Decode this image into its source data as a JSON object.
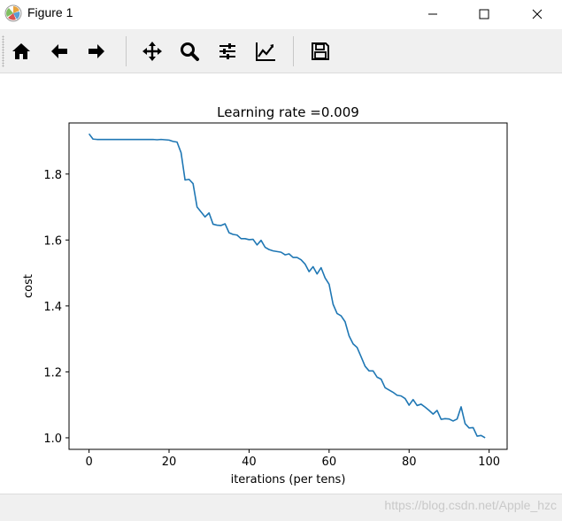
{
  "window": {
    "title": "Figure 1"
  },
  "toolbar": {
    "buttons": [
      {
        "name": "home",
        "icon": "home-icon"
      },
      {
        "name": "back",
        "icon": "arrow-left-icon"
      },
      {
        "name": "forward",
        "icon": "arrow-right-icon"
      },
      {
        "name": "pan",
        "icon": "move-icon"
      },
      {
        "name": "zoom",
        "icon": "magnifier-icon"
      },
      {
        "name": "subplots",
        "icon": "sliders-icon"
      },
      {
        "name": "edit-axes",
        "icon": "line-chart-icon"
      },
      {
        "name": "save",
        "icon": "floppy-disk-icon"
      }
    ]
  },
  "statusbar": {
    "watermark": "https://blog.csdn.net/Apple_hzc"
  },
  "colors": {
    "line": "#1f77b4",
    "toolbar_bg": "#f0f0f0"
  },
  "chart_data": {
    "type": "line",
    "title": "Learning rate =0.009",
    "xlabel": "iterations (per tens)",
    "ylabel": "cost",
    "xlim": [
      -5,
      104.5
    ],
    "ylim": [
      0.965,
      1.955
    ],
    "xticks": [
      0,
      20,
      40,
      60,
      80,
      100
    ],
    "xtick_labels": [
      "0",
      "20",
      "40",
      "60",
      "80",
      "100"
    ],
    "yticks": [
      1.0,
      1.2,
      1.4,
      1.6,
      1.8
    ],
    "ytick_labels": [
      "1.0",
      "1.2",
      "1.4",
      "1.6",
      "1.8"
    ],
    "grid": false,
    "series": [
      {
        "x": [
          0,
          1,
          2,
          3,
          4,
          5,
          6,
          7,
          8,
          9,
          10,
          11,
          12,
          13,
          14,
          15,
          16,
          17,
          18,
          19,
          20,
          21,
          22,
          23,
          24,
          25,
          26,
          27,
          28,
          29,
          30,
          31,
          32,
          33,
          34,
          35,
          36,
          37,
          38,
          39,
          40,
          41,
          42,
          43,
          44,
          45,
          46,
          47,
          48,
          49,
          50,
          51,
          52,
          53,
          54,
          55,
          56,
          57,
          58,
          59,
          60,
          61,
          62,
          63,
          64,
          65,
          66,
          67,
          68,
          69,
          70,
          71,
          72,
          73,
          74,
          75,
          76,
          77,
          78,
          79,
          80,
          81,
          82,
          83,
          84,
          85,
          86,
          87,
          88,
          89,
          90,
          91,
          92,
          93,
          94,
          95,
          96,
          97,
          98,
          99
        ],
        "values": [
          1.922,
          1.906,
          1.905,
          1.905,
          1.905,
          1.905,
          1.905,
          1.905,
          1.905,
          1.905,
          1.905,
          1.905,
          1.905,
          1.905,
          1.905,
          1.905,
          1.905,
          1.904,
          1.905,
          1.904,
          1.903,
          1.899,
          1.897,
          1.865,
          1.782,
          1.784,
          1.771,
          1.7,
          1.685,
          1.67,
          1.682,
          1.648,
          1.645,
          1.644,
          1.649,
          1.622,
          1.617,
          1.615,
          1.604,
          1.604,
          1.601,
          1.602,
          1.585,
          1.599,
          1.578,
          1.571,
          1.567,
          1.565,
          1.563,
          1.555,
          1.558,
          1.547,
          1.547,
          1.54,
          1.527,
          1.504,
          1.519,
          1.497,
          1.516,
          1.485,
          1.466,
          1.405,
          1.377,
          1.37,
          1.352,
          1.309,
          1.285,
          1.274,
          1.246,
          1.217,
          1.203,
          1.203,
          1.184,
          1.178,
          1.152,
          1.145,
          1.138,
          1.129,
          1.127,
          1.119,
          1.099,
          1.116,
          1.098,
          1.102,
          1.093,
          1.083,
          1.072,
          1.083,
          1.056,
          1.058,
          1.057,
          1.051,
          1.057,
          1.094,
          1.043,
          1.03,
          1.031,
          1.005,
          1.007,
          1.0
        ]
      }
    ]
  }
}
